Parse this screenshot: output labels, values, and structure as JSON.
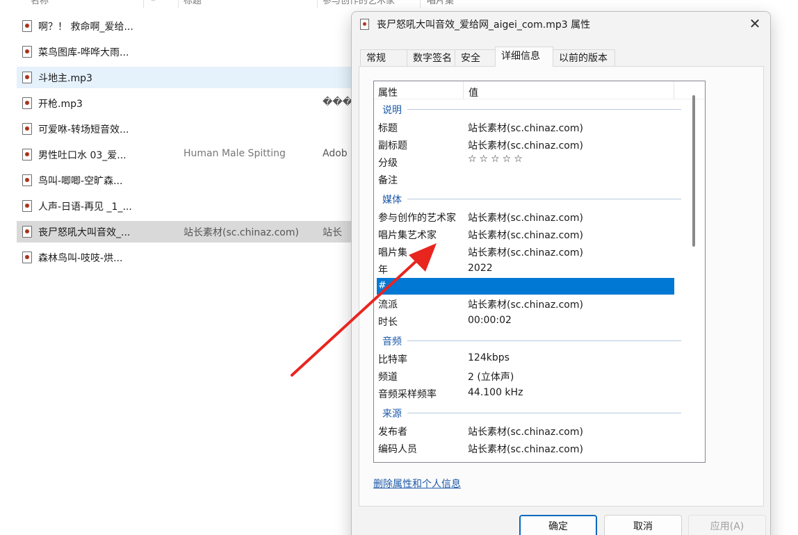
{
  "explorer": {
    "columns": [
      "名称",
      "#",
      "标题",
      "参与创作的艺术家",
      "唱片集"
    ],
    "files": [
      {
        "name": "啊？！ 救命啊_爱给...",
        "title": "",
        "artist": ""
      },
      {
        "name": "菜鸟图库-哗哗大雨...",
        "title": "",
        "artist": ""
      },
      {
        "name": "斗地主.mp3",
        "title": "",
        "artist": ""
      },
      {
        "name": "开枪.mp3",
        "title": "",
        "artist": "�����"
      },
      {
        "name": "可爱咻-转场短音效...",
        "title": "",
        "artist": ""
      },
      {
        "name": "男性吐口水 03_爱...",
        "title": "Human Male Spitting",
        "artist": "Adob"
      },
      {
        "name": "鸟叫-唧唧-空旷森...",
        "title": "",
        "artist": ""
      },
      {
        "name": "人声-日语-再见 _1_...",
        "title": "",
        "artist": ""
      },
      {
        "name": "丧尸怒吼大叫音效_...",
        "title": "站长素材(sc.chinaz.com)",
        "artist": "站长"
      },
      {
        "name": "森林鸟叫-吱吱-烘...",
        "title": "",
        "artist": ""
      }
    ]
  },
  "dialog": {
    "title": "丧尸怒吼大叫音效_爱给网_aigei_com.mp3 属性",
    "close": "✕",
    "tabs": [
      "常规",
      "数字签名",
      "安全",
      "详细信息",
      "以前的版本"
    ],
    "active_tab": "详细信息",
    "list_header": {
      "property": "属性",
      "value": "值"
    },
    "groups": {
      "description": "说明",
      "media": "媒体",
      "audio": "音频",
      "origin": "来源"
    },
    "description_rows": [
      {
        "k": "标题",
        "v": "站长素材(sc.chinaz.com)"
      },
      {
        "k": "副标题",
        "v": "站长素材(sc.chinaz.com)"
      },
      {
        "k": "分级",
        "v": "☆☆☆☆☆"
      },
      {
        "k": "备注",
        "v": ""
      }
    ],
    "media_rows": [
      {
        "k": "参与创作的艺术家",
        "v": "站长素材(sc.chinaz.com)"
      },
      {
        "k": "唱片集艺术家",
        "v": "站长素材(sc.chinaz.com)"
      },
      {
        "k": "唱片集",
        "v": "站长素材(sc.chinaz.com)"
      },
      {
        "k": "年",
        "v": "2022"
      },
      {
        "k": "#",
        "v": ""
      },
      {
        "k": "流派",
        "v": "站长素材(sc.chinaz.com)"
      },
      {
        "k": "时长",
        "v": "00:00:02"
      }
    ],
    "audio_rows": [
      {
        "k": "比特率",
        "v": "124kbps"
      },
      {
        "k": "频道",
        "v": "2 (立体声)"
      },
      {
        "k": "音频采样频率",
        "v": "44.100 kHz"
      }
    ],
    "origin_rows": [
      {
        "k": "发布者",
        "v": "站长素材(sc.chinaz.com)"
      },
      {
        "k": "编码人员",
        "v": "站长素材(sc.chinaz.com)"
      }
    ],
    "remove_link": "删除属性和个人信息",
    "buttons": {
      "ok": "确定",
      "cancel": "取消",
      "apply": "应用(A)"
    }
  },
  "colors": {
    "accent": "#0078d4",
    "link": "#1e5aa8",
    "arrow": "#e8251f",
    "hover_row": "#e5f1fb",
    "selected_row": "#d9d9d9"
  }
}
